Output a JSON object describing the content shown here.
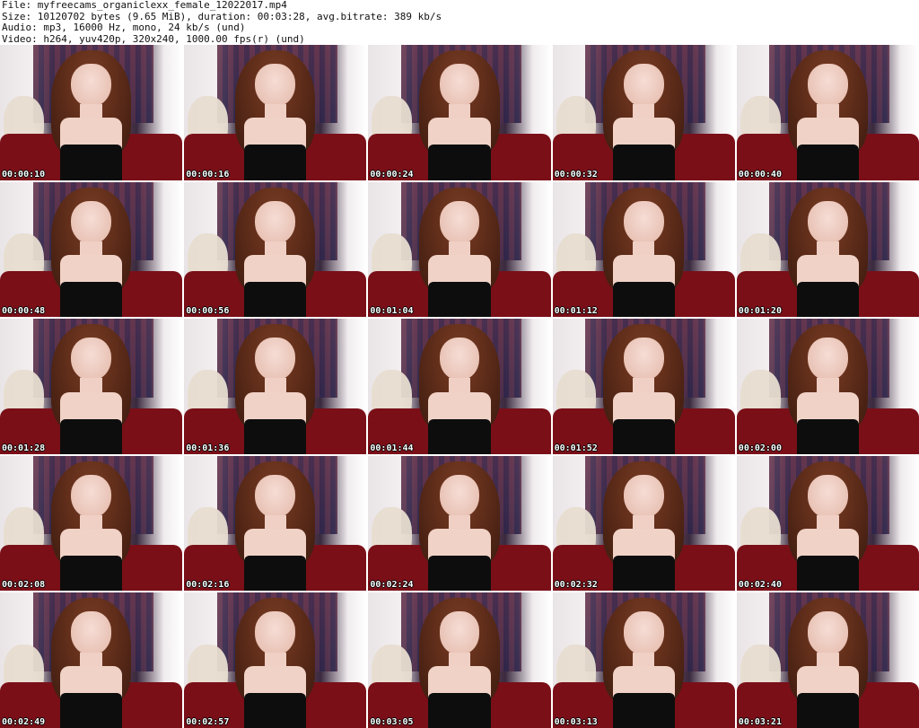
{
  "header": {
    "file": "File: myfreecams_organiclexx_female_12022017.mp4",
    "size": "Size: 10120702 bytes (9.65 MiB), duration: 00:03:28, avg.bitrate: 389 kb/s",
    "audio": "Audio: mp3, 16000 Hz, mono, 24 kb/s (und)",
    "video": "Video: h264, yuv420p, 320x240, 1000.00 fps(r) (und)"
  },
  "thumbnails": [
    {
      "time": "00:00:10"
    },
    {
      "time": "00:00:16"
    },
    {
      "time": "00:00:24"
    },
    {
      "time": "00:00:32"
    },
    {
      "time": "00:00:40"
    },
    {
      "time": "00:00:48"
    },
    {
      "time": "00:00:56"
    },
    {
      "time": "00:01:04"
    },
    {
      "time": "00:01:12"
    },
    {
      "time": "00:01:20"
    },
    {
      "time": "00:01:28"
    },
    {
      "time": "00:01:36"
    },
    {
      "time": "00:01:44"
    },
    {
      "time": "00:01:52"
    },
    {
      "time": "00:02:00"
    },
    {
      "time": "00:02:08"
    },
    {
      "time": "00:02:16"
    },
    {
      "time": "00:02:24"
    },
    {
      "time": "00:02:32"
    },
    {
      "time": "00:02:40"
    },
    {
      "time": "00:02:49"
    },
    {
      "time": "00:02:57"
    },
    {
      "time": "00:03:05"
    },
    {
      "time": "00:03:13"
    },
    {
      "time": "00:03:21"
    }
  ]
}
